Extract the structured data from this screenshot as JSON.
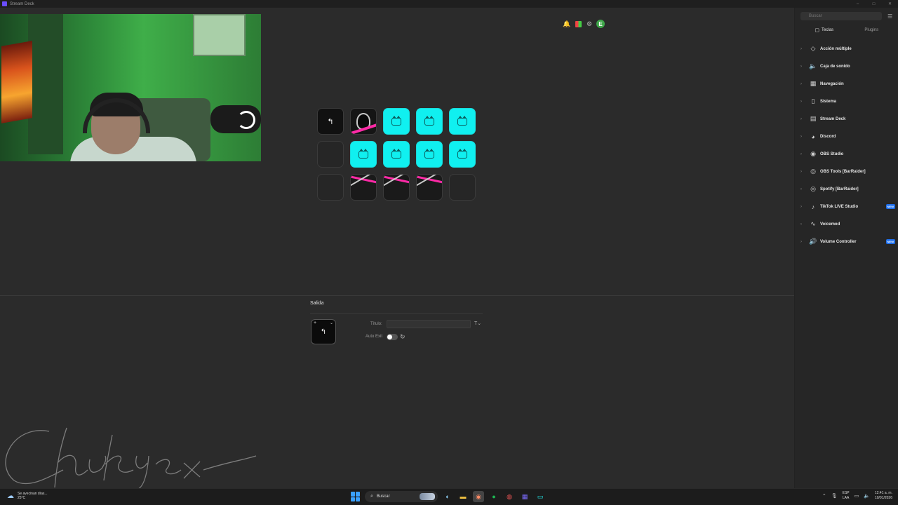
{
  "window": {
    "title": "Stream Deck",
    "controls": [
      "–",
      "□",
      "✕"
    ]
  },
  "toolbar": {
    "icons": [
      "bell-icon",
      "marketplace-icon",
      "settings-icon"
    ],
    "avatar_letter": "E"
  },
  "keys": [
    {
      "type": "back"
    },
    {
      "type": "venom"
    },
    {
      "type": "cat"
    },
    {
      "type": "cat"
    },
    {
      "type": "cat"
    },
    {
      "type": "empty"
    },
    {
      "type": "cat"
    },
    {
      "type": "cat"
    },
    {
      "type": "cat"
    },
    {
      "type": "cat"
    },
    {
      "type": "empty"
    },
    {
      "type": "neon"
    },
    {
      "type": "neon"
    },
    {
      "type": "neon"
    },
    {
      "type": "empty"
    }
  ],
  "properties": {
    "title": "Salida",
    "title_label": "Título:",
    "title_value": "",
    "auto_exit_label": "Auto Exit"
  },
  "signature_text": "Chukyex",
  "panel": {
    "search_placeholder": "Buscar",
    "tabs": [
      "Teclas",
      "Plugins"
    ],
    "categories": [
      {
        "label": "Acción múltiple",
        "icon": "multi-action-icon",
        "glyph": "◇",
        "badge": ""
      },
      {
        "label": "Caja de sonido",
        "icon": "soundboard-icon",
        "glyph": "🔈",
        "badge": ""
      },
      {
        "label": "Navegación",
        "icon": "navigation-icon",
        "glyph": "▦",
        "badge": ""
      },
      {
        "label": "Sistema",
        "icon": "system-icon",
        "glyph": "▯",
        "badge": ""
      },
      {
        "label": "Stream Deck",
        "icon": "stream-deck-icon",
        "glyph": "▤",
        "badge": ""
      },
      {
        "label": "Discord",
        "icon": "discord-icon",
        "glyph": "◕",
        "badge": ""
      },
      {
        "label": "OBS Studio",
        "icon": "obs-icon",
        "glyph": "◉",
        "badge": ""
      },
      {
        "label": "OBS Tools [BarRaider]",
        "icon": "obs-tools-icon",
        "glyph": "◎",
        "badge": ""
      },
      {
        "label": "Spotify [BarRaider]",
        "icon": "spotify-icon",
        "glyph": "◎",
        "badge": ""
      },
      {
        "label": "TikTok LIVE Studio",
        "icon": "tiktok-icon",
        "glyph": "♪",
        "badge": "NEW"
      },
      {
        "label": "Voicemod",
        "icon": "voicemod-icon",
        "glyph": "∿",
        "badge": ""
      },
      {
        "label": "Volume Controller",
        "icon": "volume-icon",
        "glyph": "🔊",
        "badge": "NEW"
      }
    ]
  },
  "taskbar": {
    "weather_line1": "Se avecinan días...",
    "weather_line2": "25°C",
    "search_label": "Buscar",
    "lang_line1": "ESP",
    "lang_line2": "LAA",
    "time": "12:41 a. m.",
    "date": "10/01/2026"
  },
  "colors": {
    "accent_cyan": "#10f0f0",
    "accent_pink": "#ff2aa6",
    "badge_blue": "#1f6feb",
    "background": "#2b2b2b"
  }
}
